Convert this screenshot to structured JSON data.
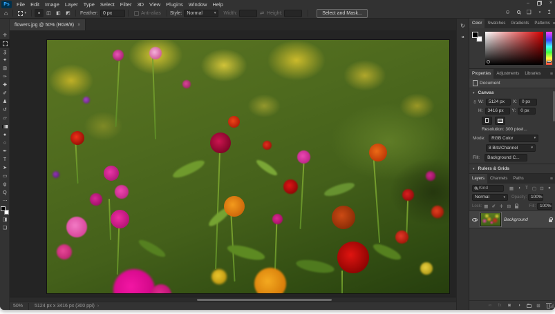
{
  "window": {
    "logo": "Ps",
    "controls": [
      {
        "name": "minimize-button",
        "glyph": "–"
      },
      {
        "name": "restore-button",
        "glyph": ""
      },
      {
        "name": "close-button",
        "glyph": "×"
      }
    ]
  },
  "menu": {
    "items": [
      "File",
      "Edit",
      "Image",
      "Layer",
      "Type",
      "Select",
      "Filter",
      "3D",
      "View",
      "Plugins",
      "Window",
      "Help"
    ]
  },
  "options": {
    "home_icon": "⌂",
    "mode_icons": [
      {
        "name": "new-selection-icon",
        "glyph": "▪",
        "active": true
      },
      {
        "name": "add-to-selection-icon",
        "glyph": "◫"
      },
      {
        "name": "subtract-from-selection-icon",
        "glyph": "◧"
      },
      {
        "name": "intersect-selection-icon",
        "glyph": "◩"
      }
    ],
    "feather_label": "Feather:",
    "feather_value": "0 px",
    "anti_alias_label": "Anti-alias",
    "style_label": "Style:",
    "style_value": "Normal",
    "width_label": "Width:",
    "swap_icon": "⇄",
    "height_label": "Height:",
    "select_and_mask_label": "Select and Mask...",
    "right_icons": [
      {
        "name": "account-icon",
        "glyph": "☺"
      },
      {
        "name": "search-icon",
        "css": "i-mag"
      },
      {
        "name": "workspace-icon",
        "glyph": "❑"
      },
      {
        "name": "share-icon",
        "glyph": "↥"
      }
    ]
  },
  "toolbar": {
    "tools": [
      {
        "name": "move-tool",
        "glyph": "✛"
      },
      {
        "name": "rectangular-marquee-tool",
        "render": "dashbox",
        "active": true
      },
      {
        "name": "lasso-tool",
        "glyph": "ʓ"
      },
      {
        "name": "quick-selection-tool",
        "glyph": "✦"
      },
      {
        "name": "crop-tool",
        "glyph": "⊞"
      },
      {
        "name": "eyedropper-tool",
        "glyph": "✑"
      },
      {
        "name": "healing-brush-tool",
        "glyph": "✚"
      },
      {
        "name": "brush-tool",
        "glyph": "✐"
      },
      {
        "name": "clone-stamp-tool",
        "glyph": "♟"
      },
      {
        "name": "history-brush-tool",
        "glyph": "↺"
      },
      {
        "name": "eraser-tool",
        "glyph": "▱"
      },
      {
        "name": "gradient-tool",
        "render": "gradbox"
      },
      {
        "name": "blur-tool",
        "glyph": "●"
      },
      {
        "name": "dodge-tool",
        "glyph": "○"
      },
      {
        "name": "pen-tool",
        "glyph": "✒"
      },
      {
        "name": "type-tool",
        "glyph": "T"
      },
      {
        "name": "path-selection-tool",
        "glyph": "➤"
      },
      {
        "name": "shape-tool",
        "glyph": "▭"
      },
      {
        "name": "hand-tool",
        "glyph": "ψ"
      },
      {
        "name": "zoom-tool",
        "glyph": "Q"
      },
      {
        "name": "edit-toolbar",
        "glyph": "⋯"
      }
    ],
    "quick_mask_glyph": "◨",
    "screen_mode_glyph": "❏"
  },
  "tab": {
    "title": "flowers.jpg @ 50% (RGB/8)",
    "close": "×"
  },
  "dock_icons": [
    {
      "name": "history-icon",
      "glyph": "↻"
    },
    {
      "name": "comments-icon",
      "glyph": "❝"
    }
  ],
  "color_panel": {
    "tabs": [
      "Color",
      "Swatches",
      "Gradients",
      "Patterns"
    ],
    "active": "Color",
    "menu_icon": "≡"
  },
  "properties": {
    "tabs": [
      "Properties",
      "Adjustments",
      "Libraries"
    ],
    "active": "Properties",
    "menu_icon": "≡",
    "document_label": "Document",
    "canvas_section": "Canvas",
    "w_label": "W:",
    "w_value": "5124 px",
    "x_label": "X:",
    "x_value": "0 px",
    "h_label": "H:",
    "h_value": "3416 px",
    "y_label": "Y:",
    "y_value": "0 px",
    "resolution_text": "Resolution: 300 pixel...",
    "mode_label": "Mode:",
    "mode_value": "RGB Color",
    "depth_value": "8 Bits/Channel",
    "fill_label": "Fill:",
    "fill_value": "Background C...",
    "rulers_section": "Rulers & Grids"
  },
  "layers": {
    "tabs": [
      "Layers",
      "Channels",
      "Paths"
    ],
    "active": "Layers",
    "menu_icon": "≡",
    "search_kind": "Kind",
    "filter_icons": [
      {
        "name": "pixel-filter-icon",
        "glyph": "▦"
      },
      {
        "name": "adjustment-filter-icon",
        "glyph": "◑"
      },
      {
        "name": "type-filter-icon",
        "glyph": "T"
      },
      {
        "name": "shape-filter-icon",
        "glyph": "▢"
      },
      {
        "name": "smart-object-filter-icon",
        "glyph": "⊡"
      },
      {
        "name": "filter-toggle-icon",
        "glyph": "●"
      }
    ],
    "blend_mode": "Normal",
    "opacity_label": "Opacity:",
    "opacity_value": "100%",
    "lock_label": "Lock:",
    "lock_icons": [
      {
        "name": "lock-transparency-icon",
        "glyph": "▦"
      },
      {
        "name": "lock-pixels-icon",
        "glyph": "✐"
      },
      {
        "name": "lock-position-icon",
        "glyph": "✛"
      },
      {
        "name": "lock-artboard-icon",
        "glyph": "⊞"
      },
      {
        "name": "lock-all-icon",
        "css": "i-lock dimlock"
      }
    ],
    "fill_label": "Fill:",
    "fill_value": "100%",
    "layer_name": "Background",
    "footer_icons": [
      {
        "name": "link-layers-icon",
        "glyph": "∞",
        "dim": true
      },
      {
        "name": "layer-effects-icon",
        "glyph": "fx",
        "dim": true
      },
      {
        "name": "layer-mask-icon",
        "glyph": "◙"
      },
      {
        "name": "adjustment-layer-icon",
        "glyph": "◑"
      },
      {
        "name": "new-group-icon",
        "css": "i-folder"
      },
      {
        "name": "new-layer-icon",
        "glyph": "⊞"
      },
      {
        "name": "delete-layer-icon",
        "css": "i-trash"
      }
    ]
  },
  "status": {
    "zoom": "50%",
    "doc_info": "5124 px x 3416 px (300 ppi)",
    "chevron": "›"
  }
}
